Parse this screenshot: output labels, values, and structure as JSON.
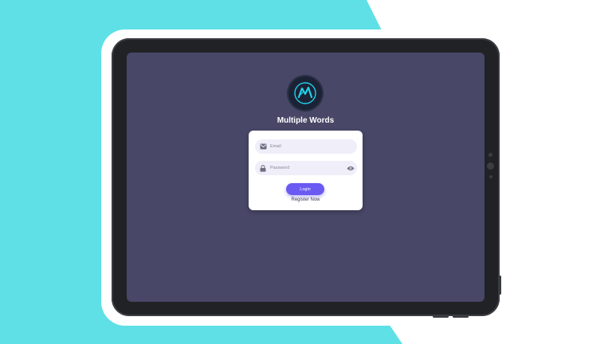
{
  "colors": {
    "backdrop": "#5ee0e6",
    "screen": "#484767",
    "accent": "#6a5af2",
    "logo_mark": "#1fd1e8"
  },
  "app": {
    "title": "Multiple Words",
    "logo_icon": "mountain-m-logo"
  },
  "form": {
    "email_placeholder": "Email",
    "email_icon": "envelope-icon",
    "password_placeholder": "Password",
    "password_icon": "lock-icon",
    "password_toggle_icon": "eye-icon",
    "login_label": "Login",
    "register_label": "Register Now"
  }
}
